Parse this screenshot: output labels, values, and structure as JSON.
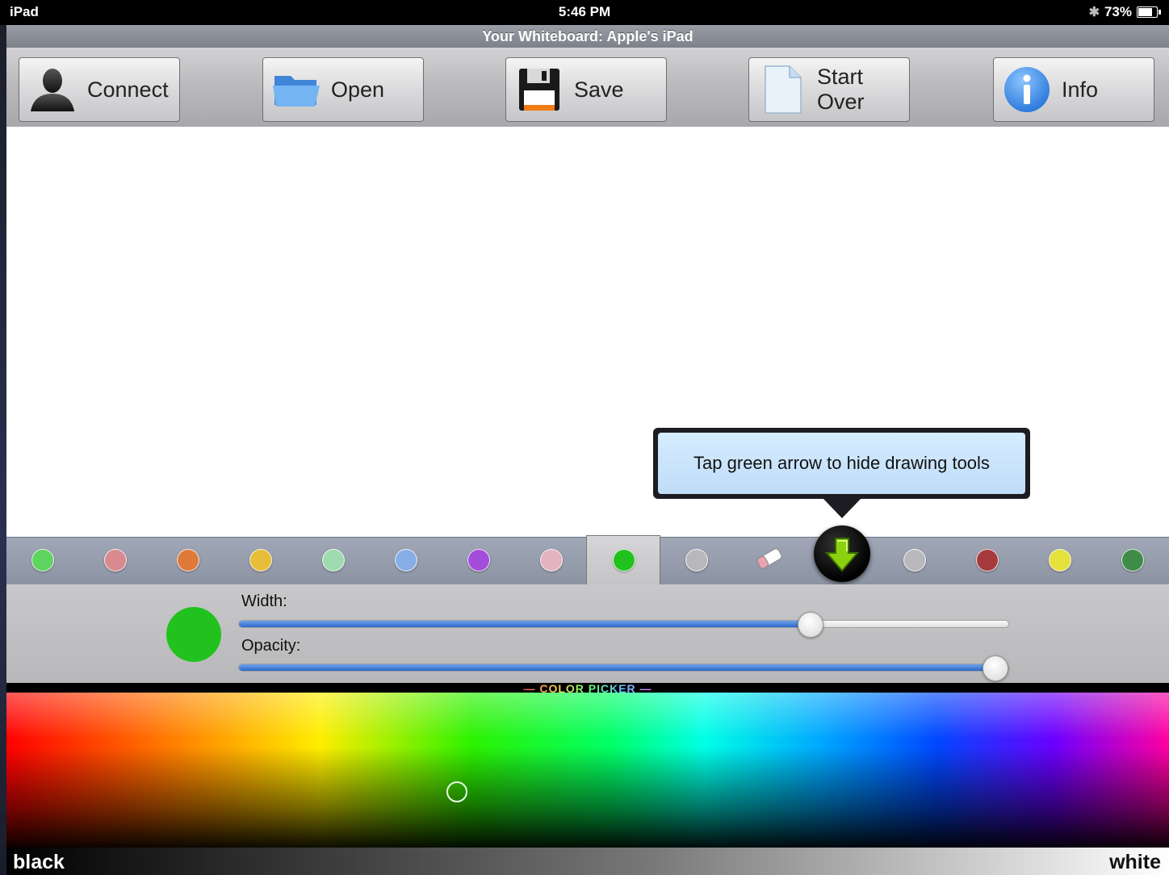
{
  "status_bar": {
    "device": "iPad",
    "time": "5:46 PM",
    "battery": "73%"
  },
  "title": "Your Whiteboard: Apple's iPad",
  "toolbar": {
    "buttons": [
      {
        "label": "Connect",
        "icon": "person-icon"
      },
      {
        "label": "Open",
        "icon": "folder-icon"
      },
      {
        "label": "Save",
        "icon": "floppy-disk-icon"
      },
      {
        "label": "Start Over",
        "icon": "blank-page-icon"
      },
      {
        "label": "Info",
        "icon": "info-icon"
      }
    ]
  },
  "tooltip": {
    "text": "Tap green arrow to hide drawing tools"
  },
  "palette": {
    "swatches": [
      "#5fd35f",
      "#d98a8e",
      "#e07a3a",
      "#e7be3a",
      "#9edcaf",
      "#88aee8",
      "#a44ddb",
      "#e3b3c1",
      "#22c21e",
      "#b8b8bc",
      "#b9b9bd",
      "#a63a3c",
      "#e5e03a",
      "#3f8c48"
    ],
    "selected_index": 8,
    "tools": [
      "eraser-icon",
      "hide-tools-arrow-icon"
    ]
  },
  "tools": {
    "current_color": "#22c21e",
    "width_label": "Width:",
    "width_value": 0.74,
    "opacity_label": "Opacity:",
    "opacity_value": 0.98
  },
  "color_picker": {
    "header": "— COLOR PICKER —",
    "left_label": "black",
    "right_label": "white"
  }
}
